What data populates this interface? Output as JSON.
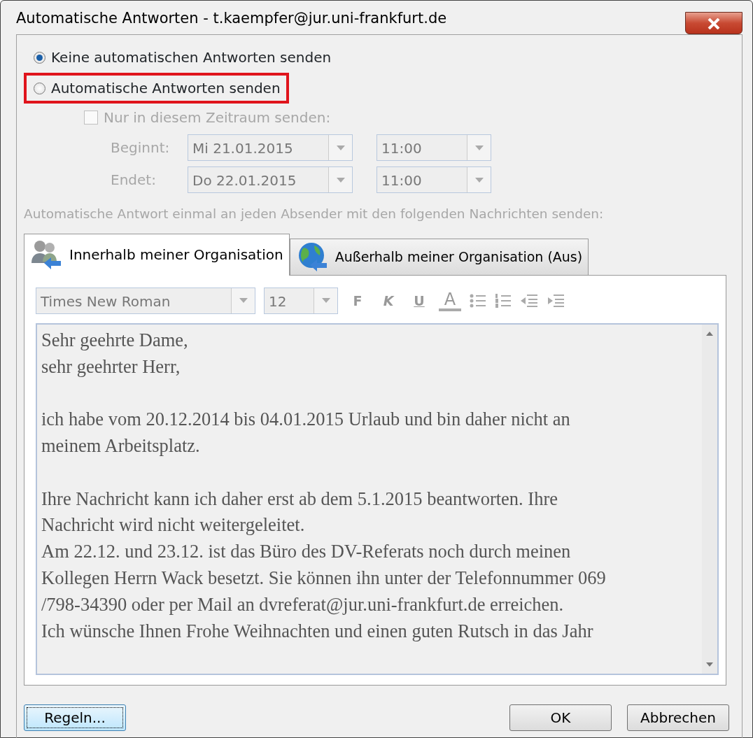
{
  "window": {
    "title": "Automatische Antworten - t.kaempfer@jur.uni-frankfurt.de"
  },
  "options": [
    {
      "label": "Keine automatischen Antworten senden",
      "selected": true,
      "highlighted": false
    },
    {
      "label": "Automatische Antworten senden",
      "selected": false,
      "highlighted": true
    }
  ],
  "period": {
    "label": "Nur in diesem Zeitraum senden:",
    "checked": false,
    "disabled": true,
    "rows": [
      {
        "label": "Beginnt:",
        "date": "Mi 21.01.2015",
        "time": "11:00"
      },
      {
        "label": "Endet:",
        "date": "Do 22.01.2015",
        "time": "11:00"
      }
    ]
  },
  "note": "Automatische Antwort einmal an jeden Absender mit den folgenden Nachrichten senden:",
  "tabs": [
    {
      "label": "Innerhalb meiner Organisation",
      "kind": "people",
      "selected": true
    },
    {
      "label": "Außerhalb meiner Organisation (Aus)",
      "kind": "globe",
      "selected": false
    }
  ],
  "toolbar": {
    "font": "Times New Roman",
    "size": "12",
    "buttons": [
      {
        "kind": "bold",
        "label": "F"
      },
      {
        "kind": "italic",
        "label": "K"
      },
      {
        "kind": "underline",
        "label": "U"
      },
      {
        "kind": "color",
        "label": "A"
      },
      {
        "kind": "bullets"
      },
      {
        "kind": "numbers"
      },
      {
        "kind": "outdent"
      },
      {
        "kind": "indent"
      }
    ]
  },
  "body": [
    [
      "Sehr geehrte Dame,",
      "sehr geehrter Herr,"
    ],
    [
      "ich habe vom 20.12.2014 bis 04.01.2015 Urlaub und bin daher nicht an",
      "meinem Arbeitsplatz."
    ],
    [
      "Ihre Nachricht kann ich daher erst ab dem 5.1.2015 beantworten. Ihre",
      "Nachricht wird nicht weitergeleitet.",
      "Am 22.12. und 23.12. ist das Büro des DV-Referats noch durch meinen",
      "Kollegen Herrn Wack besetzt. Sie können ihn unter der Telefonnummer 069",
      "/798-34390 oder per Mail an dvreferat@jur.uni-frankfurt.de erreichen.",
      "Ich wünsche Ihnen Frohe Weihnachten und einen guten Rutsch in das Jahr"
    ]
  ],
  "buttons": [
    {
      "label": "Regeln...",
      "focused": true
    },
    {
      "label": "OK",
      "focused": false
    },
    {
      "label": "Abbrechen",
      "focused": false
    }
  ]
}
